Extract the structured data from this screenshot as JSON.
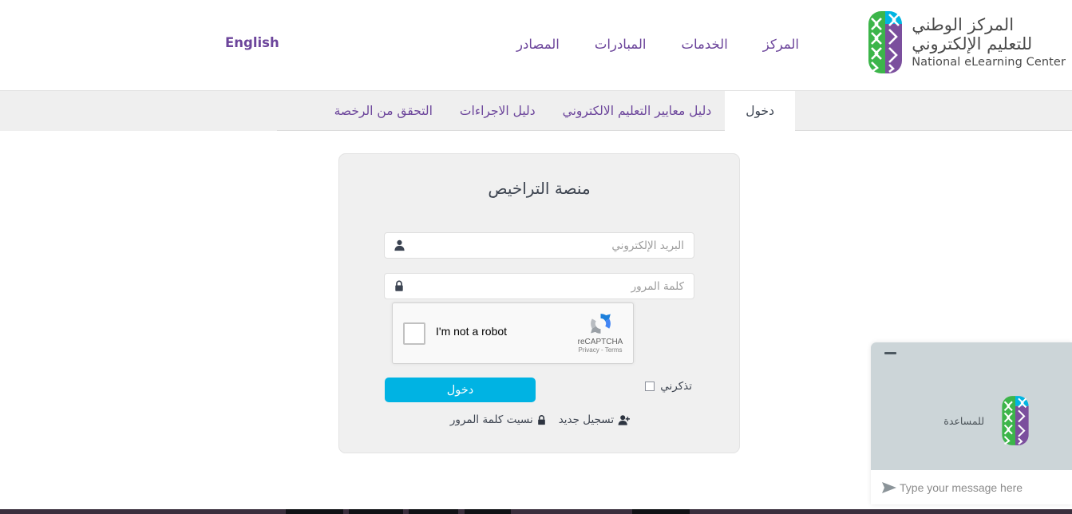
{
  "header": {
    "brand": {
      "arabic_line1": "المركز الوطني",
      "arabic_line2": "للتعليم الإلكتروني",
      "english": "National eLearning Center",
      "logo_icon": "nelc-logo-icon"
    },
    "nav_items": [
      {
        "label": "المركز",
        "name": "nav-item-center"
      },
      {
        "label": "الخدمات",
        "name": "nav-item-services"
      },
      {
        "label": "المبادرات",
        "name": "nav-item-initiatives"
      },
      {
        "label": "المصادر",
        "name": "nav-item-resources"
      }
    ],
    "language_switch": "English"
  },
  "tabbar": {
    "tabs": [
      {
        "label": "دخول",
        "active": true
      },
      {
        "label": "دليل معايير التعليم الالكتروني",
        "active": false
      },
      {
        "label": "دليل الاجراءات",
        "active": false
      },
      {
        "label": "التحقق من الرخصة",
        "active": false
      }
    ]
  },
  "login_card": {
    "title": "منصة التراخيص",
    "email": {
      "placeholder": "البريد الإلكتروني",
      "value": "",
      "icon": "user-icon"
    },
    "password": {
      "placeholder": "كلمة المرور",
      "value": "",
      "icon": "lock-icon"
    },
    "recaptcha": {
      "checkbox_label": "I'm not a robot",
      "brand": "reCAPTCHA",
      "terms": "Privacy - Terms",
      "logo_icon": "recaptcha-icon",
      "checked": false
    },
    "remember_label": "تذكرني",
    "remember_checked": false,
    "login_button": "دخول",
    "links": [
      {
        "label": "نسيت كلمة المرور",
        "icon": "lock-icon",
        "name": "forgot-password-link"
      },
      {
        "label": "تسجيل جديد",
        "icon": "user-plus-icon",
        "name": "register-link"
      }
    ]
  },
  "chat": {
    "minimize_icon": "minimize-icon",
    "logo_icon": "nelc-logo-icon",
    "message": "للمساعدة",
    "input_placeholder": "Type your message here",
    "input_value": "",
    "send_icon": "send-icon"
  },
  "colors": {
    "brand_purple": "#6c459b",
    "brand_green": "#3cb54a",
    "brand_cyan": "#00b5e2",
    "accent_button": "#00b3e3",
    "card_background": "#f0f0f0",
    "tabbar_background": "#efefef",
    "chat_background": "#ccd5d8",
    "text_dark": "#3d4450"
  }
}
